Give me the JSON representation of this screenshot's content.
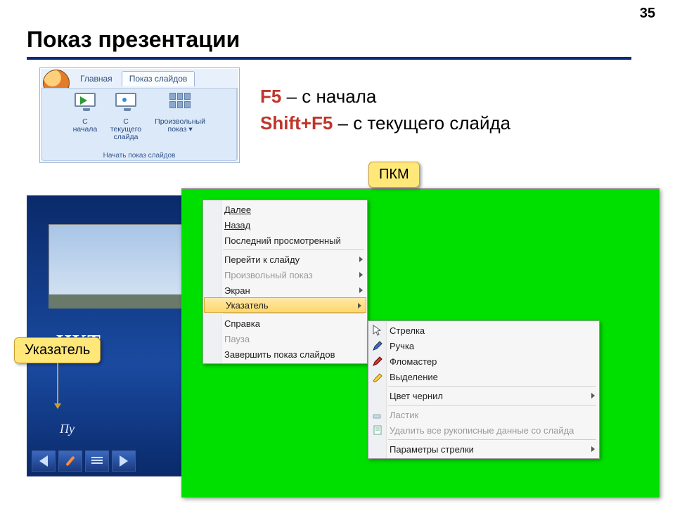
{
  "page_number": "35",
  "title": "Показ презентации",
  "ribbon": {
    "tabs": {
      "home": "Главная",
      "slideshow": "Показ слайдов"
    },
    "group_label": "Начать показ слайдов",
    "btn_from_start_l1": "С",
    "btn_from_start_l2": "начала",
    "btn_from_current_l1": "С текущего",
    "btn_from_current_l2": "слайда",
    "btn_custom_l1": "Произвольный",
    "btn_custom_l2": "показ ▾"
  },
  "shortcuts": {
    "k1": "F5",
    "t1": " – с начала",
    "k2": "Shift+F5",
    "t2": " – с текущего слайда"
  },
  "callout_pkm": "ПКМ",
  "callout_pointer": "Указатель",
  "slide": {
    "title_fragment": "НКТ",
    "subtitle_fragment": "Пу"
  },
  "menu1": {
    "next": "Далее",
    "back": "Назад",
    "last_viewed": "Последний просмотренный",
    "goto": "Перейти к слайду",
    "custom": "Произвольный показ",
    "screen": "Экран",
    "pointer": "Указатель",
    "help": "Справка",
    "pause": "Пауза",
    "end": "Завершить показ слайдов"
  },
  "menu2": {
    "arrow": "Стрелка",
    "pen": "Ручка",
    "felt": "Фломастер",
    "highlight": "Выделение",
    "ink_color": "Цвет чернил",
    "eraser": "Ластик",
    "erase_all": "Удалить все рукописные данные со слайда",
    "arrow_opts": "Параметры стрелки"
  }
}
